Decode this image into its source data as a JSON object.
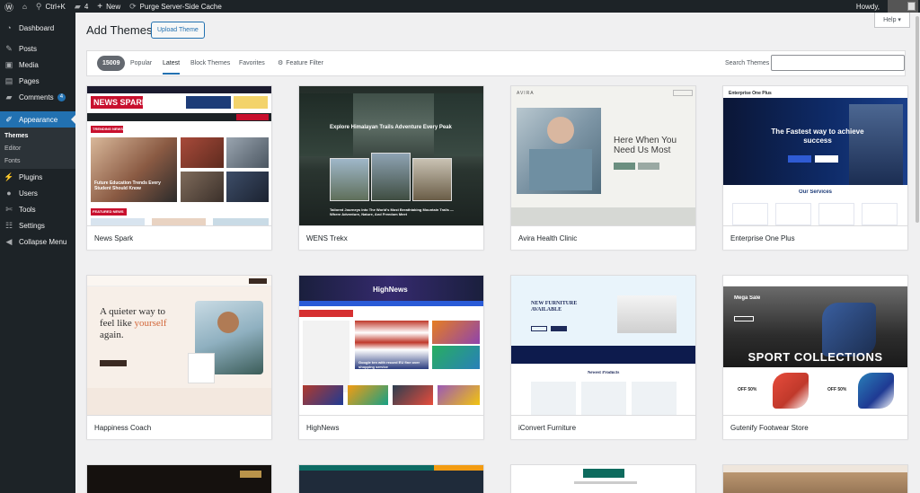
{
  "adminbar": {
    "wp_logo": "wordpress-icon",
    "home_icon": "home-icon",
    "shortcut": "Ctrl+K",
    "comments_count": "4",
    "new_label": "New",
    "purge_label": "Purge Server-Side Cache",
    "howdy": "Howdy,"
  },
  "sidebar": {
    "items": [
      {
        "label": "Dashboard",
        "icon": "dashboard-icon"
      },
      {
        "label": "Posts",
        "icon": "pin-icon"
      },
      {
        "label": "Media",
        "icon": "media-icon"
      },
      {
        "label": "Pages",
        "icon": "pages-icon"
      },
      {
        "label": "Comments",
        "icon": "comment-icon",
        "badge": "4"
      },
      {
        "label": "Appearance",
        "icon": "brush-icon"
      },
      {
        "label": "Plugins",
        "icon": "plug-icon"
      },
      {
        "label": "Users",
        "icon": "user-icon"
      },
      {
        "label": "Tools",
        "icon": "wrench-icon"
      },
      {
        "label": "Settings",
        "icon": "settings-icon"
      },
      {
        "label": "Collapse Menu",
        "icon": "collapse-icon"
      }
    ],
    "submenu": [
      "Themes",
      "Editor",
      "Fonts"
    ]
  },
  "header": {
    "title": "Add Themes",
    "upload_label": "Upload Theme",
    "help_label": "Help ▾"
  },
  "filter": {
    "count": "15009",
    "tabs": [
      "Popular",
      "Latest",
      "Block Themes",
      "Favorites"
    ],
    "feature_filter": "Feature Filter",
    "search_label": "Search Themes",
    "search_value": ""
  },
  "themes": [
    {
      "name": "News Spark"
    },
    {
      "name": "WENS Trekx"
    },
    {
      "name": "Avira Health Clinic"
    },
    {
      "name": "Enterprise One Plus"
    },
    {
      "name": "Happiness Coach"
    },
    {
      "name": "HighNews"
    },
    {
      "name": "iConvert Furniture"
    },
    {
      "name": "Gutenify Footwear Store"
    }
  ],
  "previews": {
    "newsspark": {
      "logo": "NEWS SPARK",
      "trending": "TRENDING NEWS",
      "headline": "Future Education Trends Every Student Should Know",
      "featured": "FEATURED NEWS"
    },
    "wens": {
      "headline": "Explore Himalayan Trails Adventure Every Peak",
      "caption": "Tailored Journeys Into The World's Most Breathtaking Mountain Trails — Where Adventure, Nature, And Freedom Meet"
    },
    "avira": {
      "logo": "AVIRA",
      "headline": "Here When You Need Us Most"
    },
    "enterprise": {
      "logo": "Enterprise One Plus",
      "headline": "The Fastest way to achieve success",
      "services": "Our Services"
    },
    "happiness": {
      "line1": "A quieter way to",
      "line2a": "feel like ",
      "line2b": "yourself",
      "line3": "again."
    },
    "highnews": {
      "logo": "HighNews",
      "caption": "Google ten with record EU fine over shopping service"
    },
    "iconvert": {
      "headline": "NEW FURNITURE AVAILABLE",
      "section": "Newest Products"
    },
    "gutenify": {
      "sale": "Mega Sale",
      "headline": "SPORT COLLECTIONS",
      "off1": "OFF 50%",
      "off2": "OFF 50%"
    }
  },
  "colors": {
    "accent": "#2271b1",
    "adminbar": "#1d2327"
  }
}
